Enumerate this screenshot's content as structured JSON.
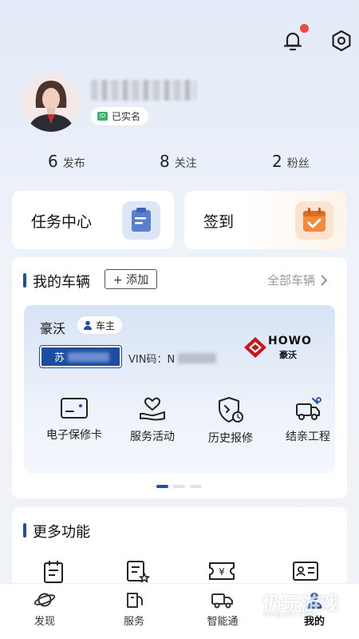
{
  "header": {
    "notification_badge_color": "#f0473e",
    "icons": [
      "bell-icon",
      "settings-icon"
    ]
  },
  "profile": {
    "verified_label": "已实名"
  },
  "stats": [
    {
      "count": "6",
      "label": "发布"
    },
    {
      "count": "8",
      "label": "关注"
    },
    {
      "count": "2",
      "label": "粉丝"
    }
  ],
  "quick_cards": {
    "task_center": "任务中心",
    "sign_in": "签到"
  },
  "vehicles": {
    "section_title": "我的车辆",
    "add_label": "+ 添加",
    "all_label": "全部车辆",
    "vehicle": {
      "brand_cn": "豪沃",
      "role": "车主",
      "plate_prefix": "苏",
      "vin_label": "VIN码：N",
      "logo_text": "HOWO",
      "logo_cn": "豪沃"
    },
    "functions": [
      {
        "label": "电子保修卡",
        "icon": "warranty-card-icon"
      },
      {
        "label": "服务活动",
        "icon": "heart-hand-icon"
      },
      {
        "label": "历史报修",
        "icon": "shield-wrench-icon"
      },
      {
        "label": "结亲工程",
        "icon": "truck-wrench-icon"
      }
    ],
    "carousel_pages": 3,
    "carousel_active": 1
  },
  "more": {
    "section_title": "更多功能"
  },
  "tabbar": [
    {
      "label": "发现",
      "icon": "planet-icon"
    },
    {
      "label": "服务",
      "icon": "service-icon"
    },
    {
      "label": "智能通",
      "icon": "truck-icon"
    },
    {
      "label": "我的",
      "icon": "profile-icon",
      "active": true
    }
  ],
  "watermark": {
    "text": "仍玩游戏",
    "sub": "Rengwan.com"
  },
  "colors": {
    "accent": "#1f4ea6",
    "badge": "#f0473e"
  }
}
